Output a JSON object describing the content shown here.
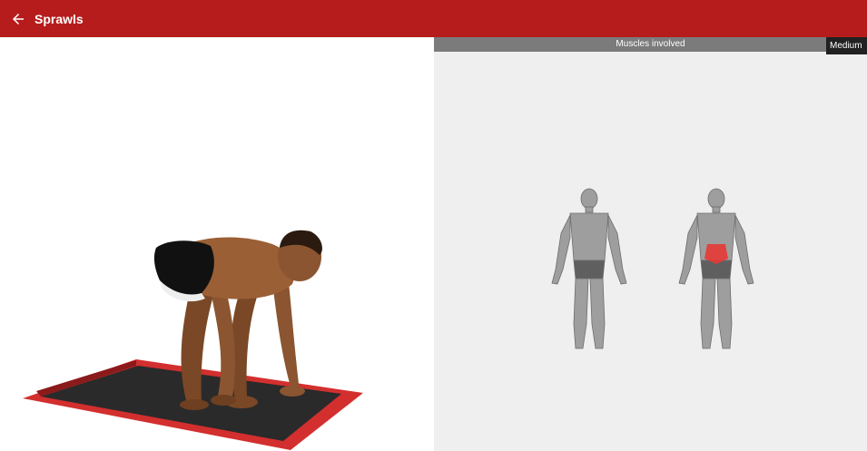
{
  "appbar": {
    "title": "Sprawls",
    "back_icon": "arrow-left-icon",
    "color": "#b71c1c"
  },
  "exercise": {
    "illustration": "athlete-on-mat-illustration",
    "mat_colors": {
      "border": "#d32f2f",
      "inner": "#2b2b2b"
    }
  },
  "muscles": {
    "header": "Muscles involved",
    "difficulty": "Medium",
    "highlight_color": "#e53935",
    "figures": [
      "front-body-figure",
      "back-body-figure"
    ]
  }
}
